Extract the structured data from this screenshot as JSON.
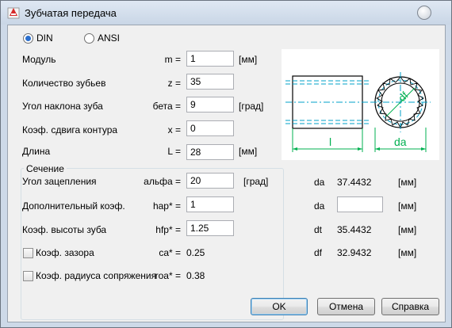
{
  "window": {
    "title": "Зубчатая передача"
  },
  "standard": {
    "din_label": "DIN",
    "ansi_label": "ANSI",
    "selected": "DIN"
  },
  "fields": {
    "module": {
      "label": "Модуль",
      "symbol": "m =",
      "value": "1",
      "unit": "[мм]"
    },
    "teeth": {
      "label": "Количество зубьев",
      "symbol": "z =",
      "value": "35"
    },
    "helix_angle": {
      "label": "Угол наклона зуба",
      "symbol": "бета =",
      "value": "9",
      "unit": "[град]"
    },
    "shift": {
      "label": "Коэф. сдвига контура",
      "symbol": "x =",
      "value": "0"
    },
    "length": {
      "label": "Длина",
      "symbol": "L =",
      "value": "28",
      "unit": "[мм]"
    }
  },
  "section": {
    "title": "Сечение",
    "pressure_angle": {
      "label": "Угол зацепления",
      "symbol": "альфа =",
      "value": "20",
      "unit": "[град]"
    },
    "addendum": {
      "label": "Дополнительный коэф.",
      "symbol": "hap* =",
      "value": "1"
    },
    "tooth_height": {
      "label": "Коэф. высоты зуба",
      "symbol": "hfp* =",
      "value": "1.25"
    },
    "clearance": {
      "label": "Коэф. зазора",
      "symbol": "ca* =",
      "value": "0.25",
      "checked": false
    },
    "fillet": {
      "label": "Коэф. радиуса сопряжения",
      "symbol": "roa* =",
      "value": "0.38",
      "checked": false
    }
  },
  "results": {
    "da": {
      "label": "da",
      "value": "37.4432",
      "unit": "[мм]"
    },
    "da_input": {
      "label": "da",
      "value": "",
      "unit": "[мм]"
    },
    "dt": {
      "label": "dt",
      "value": "35.4432",
      "unit": "[мм]"
    },
    "df": {
      "label": "df",
      "value": "32.9432",
      "unit": "[мм]"
    }
  },
  "diagram": {
    "label_l": "l",
    "label_da": "da",
    "label_df": "df"
  },
  "buttons": {
    "ok": "OK",
    "cancel": "Отмена",
    "help": "Справка"
  }
}
